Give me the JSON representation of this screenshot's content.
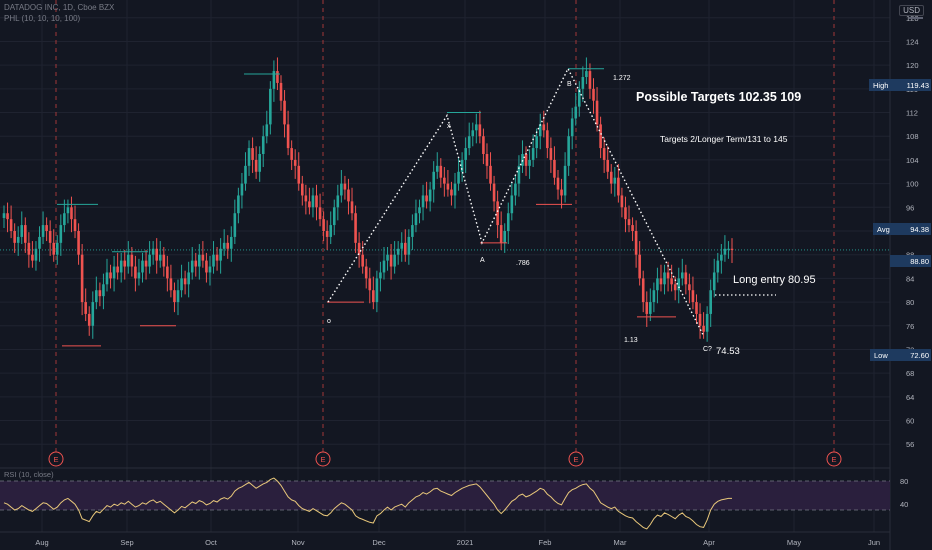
{
  "header": {
    "symbol_line": "DATADOG INC, 1D, Cboe BZX",
    "indicator_line": "PHL (10, 10, 10, 100)",
    "currency_badge": "USD"
  },
  "rsi_panel": {
    "label": "RSI (10, close)",
    "levels": [
      80,
      40
    ]
  },
  "colors": {
    "background": "#131722",
    "up_candle": "#26a69a",
    "down_candle": "#ef5350",
    "rsi_line": "#e8c77a",
    "rsi_band": "#2a1f3d",
    "grid": "#1f2330"
  },
  "annotations": {
    "possible_targets": "Possible Targets  102.35  109",
    "targets_2": "Targets 2/Longer Term/131 to 145",
    "long_entry": "Long entry 80.95",
    "c_price": "74.53",
    "fib_1272": "1.272",
    "fib_786": ".786",
    "fib_113": "1.13",
    "pivot_o": "o",
    "pivot_x": "x",
    "pivot_a": "A",
    "pivot_b": "B",
    "pivot_c": "C?"
  },
  "price_badges": {
    "high": {
      "label": "High",
      "value": "119.43"
    },
    "avg": {
      "label": "Avg",
      "value": "94.38"
    },
    "last": {
      "value": "88.80"
    },
    "low": {
      "label": "Low",
      "value": "72.60"
    }
  },
  "earnings_marker": "E",
  "chart_data": {
    "type": "candlestick",
    "title": "DATADOG INC, 1D, Cboe BZX",
    "y_axis_ticks": [
      "128",
      "124",
      "120",
      "116",
      "112",
      "108",
      "104",
      "100",
      "96",
      "92",
      "88",
      "84",
      "80",
      "76",
      "72",
      "68",
      "64",
      "60",
      "56"
    ],
    "ylim": [
      53,
      131
    ],
    "x_axis_ticks": [
      "Aug",
      "Sep",
      "Oct",
      "Nov",
      "Dec",
      "2021",
      "Feb",
      "Mar",
      "Apr",
      "May",
      "Jun"
    ],
    "pattern_points": [
      {
        "label": "o",
        "value": 80
      },
      {
        "label": "x",
        "value": 111.5
      },
      {
        "label": "A",
        "value": 90
      },
      {
        "label": "B",
        "value": 119.4
      },
      {
        "label": "C?",
        "value": 74.5
      }
    ],
    "candles_close": [
      95,
      94,
      92,
      90,
      91,
      93,
      90,
      88,
      87,
      89,
      91,
      93,
      92,
      90,
      88,
      90,
      93,
      95,
      96,
      94,
      92,
      88,
      80,
      78,
      76,
      80,
      82,
      81,
      83,
      85,
      84,
      86,
      85,
      87,
      86,
      88,
      86,
      84,
      85,
      87,
      86,
      88,
      89,
      87,
      88,
      86,
      84,
      82,
      80,
      82,
      84,
      83,
      85,
      87,
      86,
      88,
      87,
      85,
      86,
      88,
      87,
      89,
      90,
      89,
      91,
      95,
      98,
      100,
      103,
      106,
      104,
      102,
      105,
      108,
      110,
      116,
      119,
      117,
      114,
      110,
      106,
      104,
      103,
      100,
      98,
      97,
      96,
      98,
      96,
      94,
      92,
      91,
      93,
      96,
      98,
      100,
      99,
      97,
      95,
      90,
      88,
      86,
      84,
      82,
      80,
      84,
      85,
      87,
      88,
      86,
      88,
      89,
      90,
      88,
      91,
      93,
      95,
      96,
      98,
      97,
      99,
      102,
      103,
      101,
      100,
      99,
      98,
      100,
      102,
      104,
      106,
      108,
      109,
      110,
      108,
      105,
      103,
      100,
      97,
      93,
      90,
      92,
      95,
      98,
      100,
      103,
      105,
      103,
      104,
      106,
      108,
      110,
      109,
      106,
      104,
      101,
      99,
      98,
      103,
      108,
      111,
      113,
      116,
      118,
      119,
      116,
      114,
      110,
      106,
      104,
      102,
      100,
      101,
      98,
      96,
      94,
      93,
      92,
      88,
      84,
      80,
      78,
      80,
      82,
      84,
      83,
      85,
      84,
      83,
      82,
      84,
      85,
      83,
      82,
      80,
      78,
      76,
      75,
      78,
      82,
      85,
      87,
      88,
      89,
      89,
      88.8
    ],
    "rsi_values": [
      50,
      48,
      44,
      40,
      42,
      46,
      43,
      40,
      38,
      42,
      46,
      50,
      49,
      45,
      41,
      44,
      50,
      54,
      56,
      52,
      48,
      40,
      28,
      26,
      24,
      32,
      38,
      36,
      41,
      46,
      44,
      48,
      46,
      50,
      48,
      52,
      48,
      44,
      46,
      50,
      48,
      52,
      54,
      50,
      52,
      48,
      44,
      40,
      36,
      40,
      45,
      43,
      47,
      51,
      49,
      53,
      51,
      47,
      49,
      53,
      51,
      55,
      57,
      55,
      59,
      66,
      70,
      72,
      75,
      78,
      74,
      70,
      73,
      76,
      78,
      82,
      84,
      80,
      74,
      66,
      58,
      54,
      52,
      46,
      42,
      40,
      38,
      42,
      39,
      36,
      33,
      32,
      36,
      42,
      46,
      50,
      48,
      44,
      40,
      32,
      29,
      27,
      25,
      23,
      22,
      32,
      35,
      40,
      44,
      40,
      44,
      46,
      48,
      44,
      50,
      54,
      58,
      60,
      64,
      62,
      65,
      69,
      70,
      66,
      64,
      62,
      60,
      64,
      67,
      70,
      72,
      74,
      75,
      76,
      72,
      66,
      60,
      54,
      48,
      40,
      35,
      40,
      46,
      52,
      55,
      60,
      62,
      58,
      60,
      63,
      66,
      70,
      68,
      62,
      58,
      53,
      49,
      47,
      56,
      64,
      68,
      70,
      73,
      75,
      76,
      70,
      66,
      58,
      50,
      47,
      44,
      42,
      44,
      38,
      35,
      32,
      30,
      29,
      24,
      20,
      16,
      14,
      20,
      28,
      33,
      31,
      36,
      34,
      31,
      28,
      33,
      36,
      31,
      29,
      25,
      20,
      17,
      16,
      26,
      40,
      48,
      52,
      54,
      55,
      56,
      56
    ]
  }
}
